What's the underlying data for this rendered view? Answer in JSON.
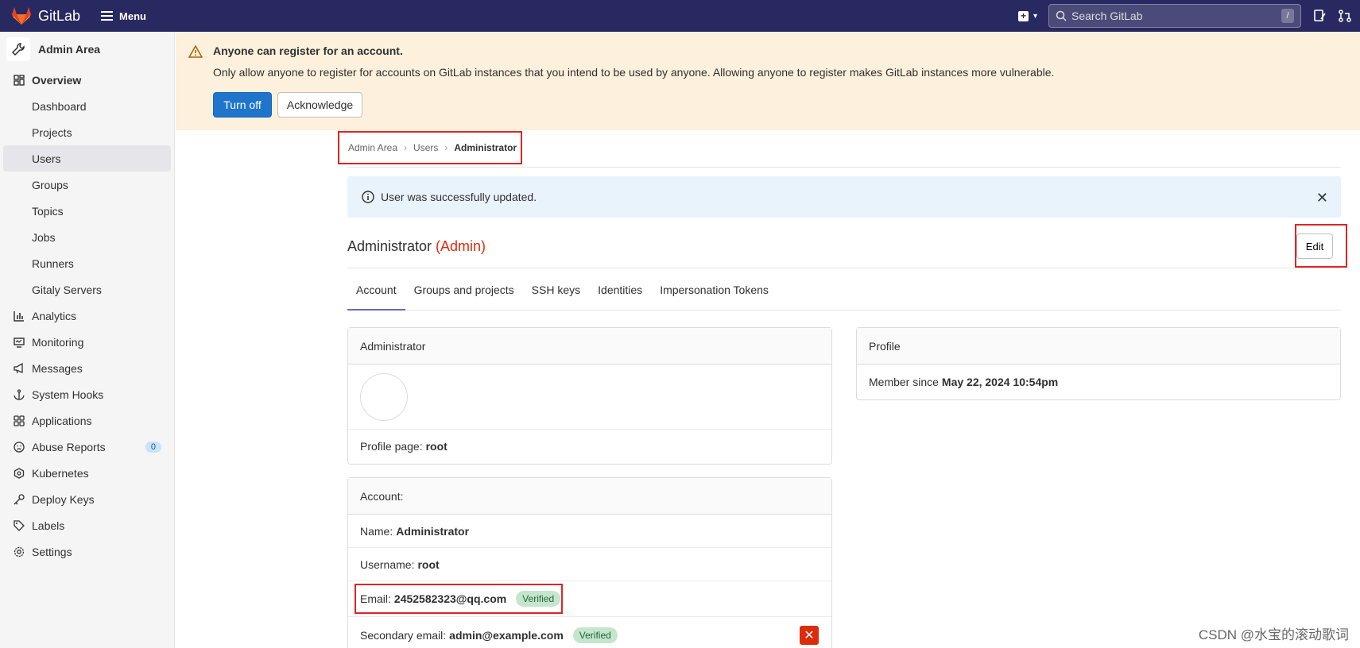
{
  "topbar": {
    "brand": "GitLab",
    "menu_label": "Menu",
    "search_placeholder": "Search GitLab",
    "search_shortcut": "/"
  },
  "sidebar": {
    "title": "Admin Area",
    "items": [
      {
        "label": "Overview",
        "icon": "overview-icon"
      },
      {
        "label": "Dashboard"
      },
      {
        "label": "Projects"
      },
      {
        "label": "Users"
      },
      {
        "label": "Groups"
      },
      {
        "label": "Topics"
      },
      {
        "label": "Jobs"
      },
      {
        "label": "Runners"
      },
      {
        "label": "Gitaly Servers"
      },
      {
        "label": "Analytics",
        "icon": "analytics-icon"
      },
      {
        "label": "Monitoring",
        "icon": "monitor-icon"
      },
      {
        "label": "Messages",
        "icon": "megaphone-icon"
      },
      {
        "label": "System Hooks",
        "icon": "anchor-icon"
      },
      {
        "label": "Applications",
        "icon": "applications-icon"
      },
      {
        "label": "Abuse Reports",
        "icon": "abuse-icon",
        "count": "0"
      },
      {
        "label": "Kubernetes",
        "icon": "kubernetes-icon"
      },
      {
        "label": "Deploy Keys",
        "icon": "key-icon"
      },
      {
        "label": "Labels",
        "icon": "label-icon"
      },
      {
        "label": "Settings",
        "icon": "settings-icon"
      }
    ]
  },
  "banner": {
    "title": "Anyone can register for an account.",
    "text": "Only allow anyone to register for accounts on GitLab instances that you intend to be used by anyone. Allowing anyone to register makes GitLab instances more vulnerable.",
    "turn_off": "Turn off",
    "acknowledge": "Acknowledge"
  },
  "breadcrumb": [
    "Admin Area",
    "Users",
    "Administrator"
  ],
  "alert": {
    "text": "User was successfully updated."
  },
  "page": {
    "name": "Administrator",
    "role": "(Admin)",
    "edit": "Edit"
  },
  "tabs": [
    "Account",
    "Groups and projects",
    "SSH keys",
    "Identities",
    "Impersonation Tokens"
  ],
  "profile_card": {
    "header": "Administrator",
    "profile_page_label": "Profile page:",
    "profile_page_value": "root"
  },
  "account_card": {
    "header": "Account:",
    "name_label": "Name:",
    "name_value": "Administrator",
    "username_label": "Username:",
    "username_value": "root",
    "email_label": "Email:",
    "email_value": "2452582323@qq.com",
    "verified": "Verified",
    "secondary_label": "Secondary email:",
    "secondary_value": "admin@example.com"
  },
  "profile_side": {
    "header": "Profile",
    "member_label": "Member since",
    "member_value": "May 22, 2024 10:54pm"
  },
  "watermark": "CSDN @水宝的滚动歌词",
  "colors": {
    "topbar": "#292961",
    "banner": "#fdf1dd",
    "primary": "#1f75cb",
    "danger": "#dd2b0e",
    "highlight_box": "#e02424"
  }
}
